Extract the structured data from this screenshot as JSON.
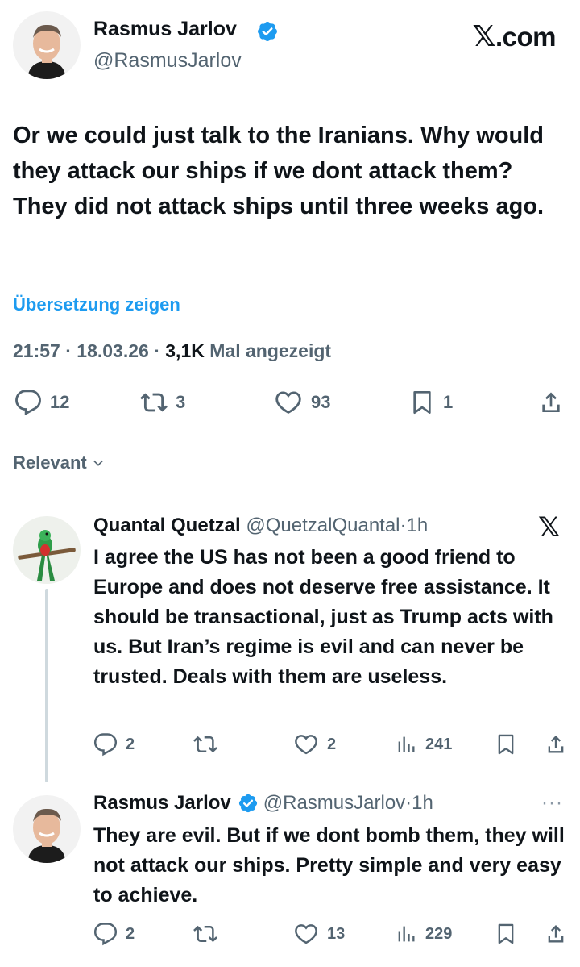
{
  "main_tweet": {
    "author_name": "Rasmus Jarlov",
    "handle": "@RasmusJarlov",
    "site_label": ".com",
    "text": "Or we could just talk to the Iranians. Why would they attack our ships if we dont attack them? They did not attack ships until three weeks ago.",
    "translate_label": "Übersetzung zeigen",
    "time": "21:57",
    "date": "18.03.26",
    "views_count": "3,1K",
    "views_label": "Mal angezeigt",
    "replies": "12",
    "reposts": "3",
    "likes": "93",
    "bookmarks": "1"
  },
  "sort": {
    "label": "Relevant"
  },
  "replies": [
    {
      "author_name": "Quantal Quetzal",
      "handle": "@QuetzalQuantal",
      "age": "1h",
      "text": "I agree the US has not been a good friend to Europe and does not deserve free assistance. It should be transactional, just as Trump acts with us. But Iran’s regime is evil and can never be trusted. Deals with them are useless.",
      "replies": "2",
      "likes": "2",
      "views": "241"
    },
    {
      "author_name": "Rasmus Jarlov",
      "handle": "@RasmusJarlov",
      "age": "1h",
      "text": "They are evil. But if we dont bomb them, they will not attack our ships. Pretty simple and very easy to achieve.",
      "replies": "2",
      "likes": "13",
      "views": "229"
    }
  ],
  "colors": {
    "verified": "#1d9bf0",
    "link": "#1d9bf0",
    "secondary": "#536471",
    "text": "#0f1419"
  },
  "icons": [
    "verified-badge-icon",
    "x-logo-icon",
    "reply-icon",
    "repost-icon",
    "like-icon",
    "bookmark-icon",
    "share-icon",
    "views-icon",
    "chevron-down-icon",
    "more-icon"
  ]
}
